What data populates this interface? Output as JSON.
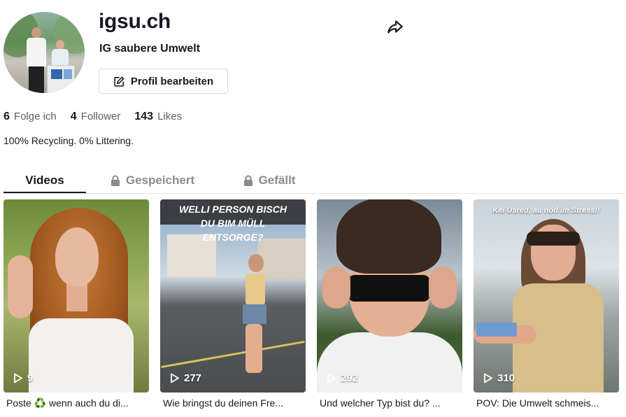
{
  "profile": {
    "username": "igsu.ch",
    "nickname": "IG saubere Umwelt",
    "edit_label": "Profil bearbeiten",
    "bio": "100% Recycling. 0% Littering."
  },
  "stats": {
    "following": {
      "value": "6",
      "label": "Folge ich"
    },
    "followers": {
      "value": "4",
      "label": "Follower"
    },
    "likes": {
      "value": "143",
      "label": "Likes"
    }
  },
  "tabs": [
    {
      "label": "Videos",
      "active": true,
      "locked": false
    },
    {
      "label": "Gespeichert",
      "active": false,
      "locked": true
    },
    {
      "label": "Gefällt",
      "active": false,
      "locked": true
    }
  ],
  "videos": [
    {
      "views": "9",
      "caption_before": "Poste",
      "caption_emoji": "♻️",
      "caption_after": " wenn auch du di..."
    },
    {
      "views": "277",
      "caption": "Wie bringst du deinen Fre...",
      "overlay": "WELLI PERSON BISCH DU BIM MÜLL ENTSORGE?"
    },
    {
      "views": "292",
      "caption": "Und welcher Typ bist du? ..."
    },
    {
      "views": "310",
      "caption": "POV: Die Umwelt schmeis...",
      "overlay": "Kei Usred, au nöd im Stress!!"
    }
  ],
  "icons": {
    "share": "share-icon",
    "edit": "edit-icon",
    "lock": "lock-icon",
    "play": "play-icon"
  },
  "colors": {
    "text": "#161823",
    "muted": "#8a8b91",
    "border": "#d9d9dc"
  }
}
